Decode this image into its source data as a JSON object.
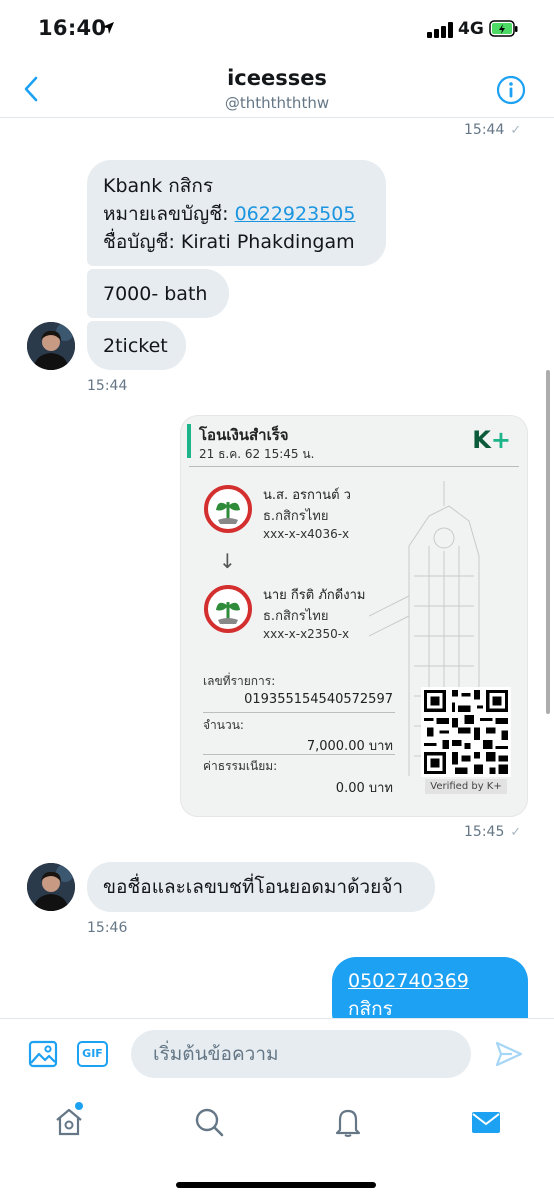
{
  "status_bar": {
    "time": "16:40",
    "network": "4G"
  },
  "header": {
    "title": "iceesses",
    "handle": "@thththththw"
  },
  "messages": {
    "ts_top": "15:44",
    "kbank_line1": "Kbank กสิกร",
    "kbank_line2_label": "หมายเลขบัญชี: ",
    "kbank_line2_link": "0622923505",
    "kbank_line3": "ชื่อบัญชี: Kirati  Phakdingam",
    "amount_msg": "7000- bath",
    "ticket_msg": "2ticket",
    "ts_group1": "15:44",
    "ts_receipt": "15:45",
    "ask_msg": "ขอชื่อและเลขบชที่โอนยอดมาด้วยจ้า",
    "ts_ask": "15:46",
    "out_link": "0502740369",
    "out_line2": "กสิกร"
  },
  "receipt": {
    "title": "โอนเงินสำเร็จ",
    "date": "21 ธ.ค. 62  15:45 น.",
    "logo_k": "K",
    "logo_plus": "+",
    "sender_name": "น.ส. อรกานต์ ว",
    "sender_bank": "ธ.กสิกรไทย",
    "sender_acct": "xxx-x-x4036-x",
    "arrow": "↓",
    "receiver_name": "นาย กีรติ ภักดีงาม",
    "receiver_bank": "ธ.กสิกรไทย",
    "receiver_acct": "xxx-x-x2350-x",
    "ref_label": "เลขที่รายการ:",
    "ref_value": "019355154540572597",
    "amount_label": "จำนวน:",
    "amount_value": "7,000.00 บาท",
    "fee_label": "ค่าธรรมเนียม:",
    "fee_value": "0.00 บาท",
    "verified": "Verified by K+"
  },
  "composer": {
    "gif_label": "GIF",
    "placeholder": "เริ่มต้นข้อความ"
  },
  "colors": {
    "accent": "#1da1f2",
    "incoming_bubble": "#e6ecf0",
    "kbank_green": "#1db48a"
  },
  "icons": {
    "back": "chevron-left-icon",
    "info": "info-icon",
    "media": "image-icon",
    "send": "send-icon",
    "home": "home-icon",
    "search": "search-icon",
    "notifications": "bell-icon",
    "messages": "mail-icon"
  }
}
